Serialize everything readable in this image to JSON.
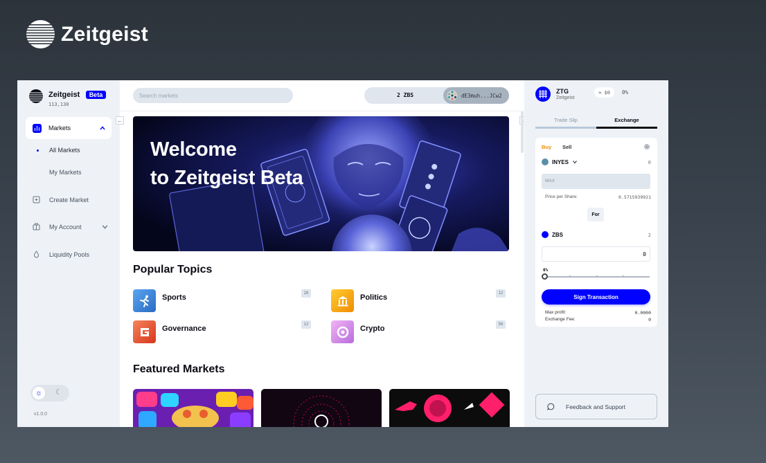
{
  "brand": {
    "name": "Zeitgeist"
  },
  "sidebar": {
    "title": "Zeitgeist",
    "badge": "Beta",
    "block_number": "113,130",
    "nav": [
      {
        "label": "Markets",
        "icon": "bar-chart-icon"
      },
      {
        "label": "Create Market",
        "icon": "plus-square-icon"
      },
      {
        "label": "My Account",
        "icon": "briefcase-icon"
      },
      {
        "label": "Liquidity Pools",
        "icon": "droplet-icon"
      }
    ],
    "subnav": [
      {
        "label": "All Markets"
      },
      {
        "label": "My Markets"
      }
    ],
    "version": "v1.0.0"
  },
  "topbar": {
    "search_placeholder": "Search markets",
    "balance": "2 ZBS",
    "account": "dE3muh...JCw2"
  },
  "hero": {
    "line1": "Welcome",
    "line2": "to Zeitgeist Beta"
  },
  "popular_topics": {
    "title": "Popular Topics",
    "items": [
      {
        "name": "Sports",
        "count": "28",
        "icon": "runner-icon",
        "color": "#3a86d8"
      },
      {
        "name": "Politics",
        "count": "12",
        "icon": "capitol-icon",
        "color": "#f5a300"
      },
      {
        "name": "Governance",
        "count": "12",
        "icon": "governance-icon",
        "color": "#e8552f"
      },
      {
        "name": "Crypto",
        "count": "56",
        "icon": "crypto-icon",
        "color": "#d68ee8"
      }
    ]
  },
  "featured": {
    "title": "Featured Markets"
  },
  "right_panel": {
    "token_symbol": "ZTG",
    "token_name": "Zeitgeist",
    "price": "≈ $0",
    "change": "0%",
    "tabs": [
      {
        "label": "Trade Slip"
      },
      {
        "label": "Exchange"
      }
    ],
    "buy_label": "Buy",
    "sell_label": "Sell",
    "asset_in": {
      "symbol": "INYES",
      "balance": "0",
      "color": "#5a8fa8"
    },
    "max_placeholder": "MAX",
    "price_per_share_label": "Price per Share:",
    "price_per_share_value": "0.5715939921",
    "for_label": "For",
    "asset_out": {
      "symbol": "ZBS",
      "balance": "2",
      "color": "#0001fe"
    },
    "amount_value": "0",
    "slider_pct": "0%",
    "slider_value": 0,
    "sign_label": "Sign Transaction",
    "max_profit_label": "Max profit:",
    "max_profit_value": "0.0000",
    "exchange_fee_label": "Exchange Fee:",
    "exchange_fee_value": "0"
  },
  "feedback": {
    "label": "Feedback and Support"
  },
  "colors": {
    "accent": "#0001fe",
    "buy": "#ef8a00"
  }
}
